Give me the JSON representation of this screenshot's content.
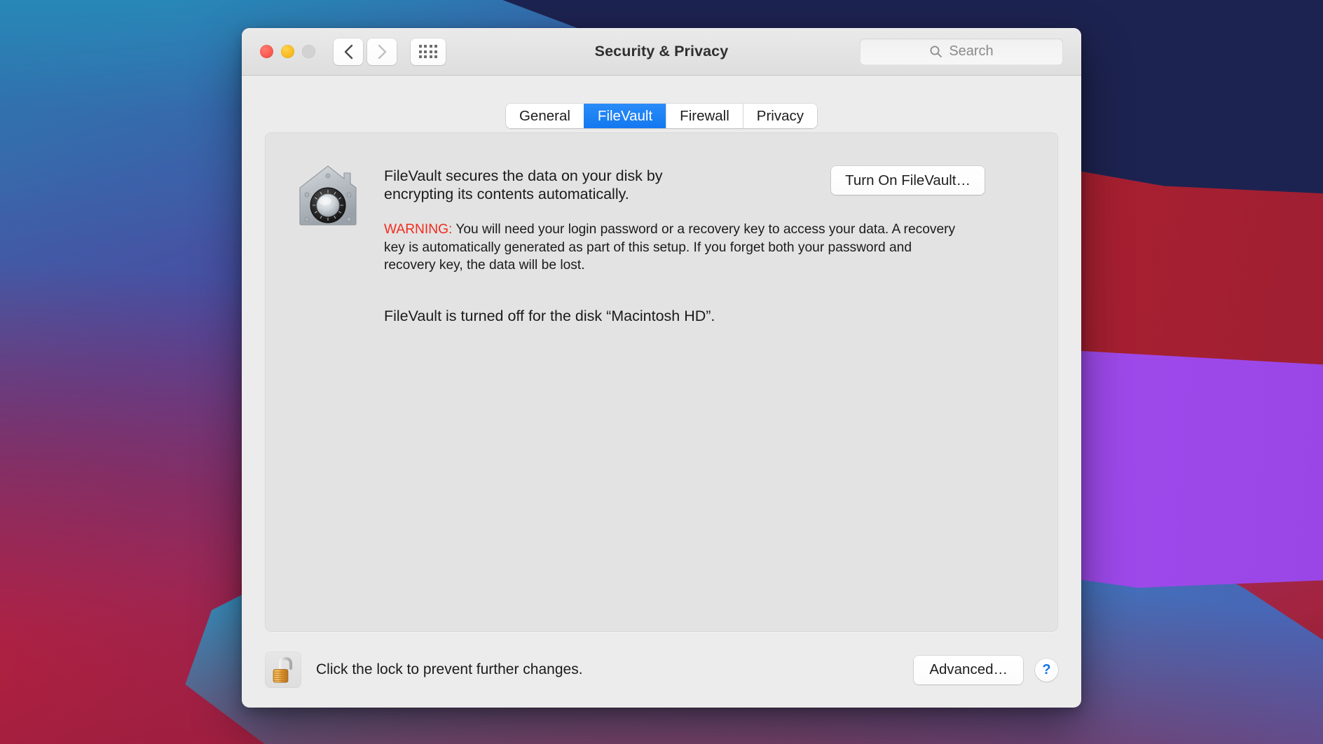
{
  "desktop": {
    "wallpaper_name": "big-sur-wallpaper",
    "colors": {
      "navy": "#1d2350",
      "red": "#c4262b",
      "purple": "#9a4ee8",
      "teal": "#2a9ec4",
      "blue": "#4a63b4",
      "crimson": "#a32440"
    }
  },
  "window": {
    "title": "Security & Privacy",
    "traffic_lights": {
      "close_label": "Close",
      "minimize_label": "Minimize",
      "zoom_label": "Zoom",
      "close_color": "#fa5d52",
      "minimize_color": "#f9bd23",
      "zoom_color": "#d2d2d2"
    },
    "nav": {
      "back_label": "Back",
      "forward_label": "Forward",
      "grid_label": "Show All"
    },
    "search": {
      "placeholder": "Search",
      "value": "",
      "icon": "search-icon"
    }
  },
  "tabs": [
    {
      "label": "General",
      "selected": false
    },
    {
      "label": "FileVault",
      "selected": true
    },
    {
      "label": "Firewall",
      "selected": false
    },
    {
      "label": "Privacy",
      "selected": false
    }
  ],
  "tab_accent_color": "#1378f0",
  "filevault": {
    "icon_name": "filevault-vault-icon",
    "description": "FileVault secures the data on your disk by encrypting its contents automatically.",
    "warning_label": "WARNING:",
    "warning_color": "#f12b1e",
    "warning_text": " You will need your login password or a recovery key to access your data. A recovery key is automatically generated as part of this setup. If you forget both your password and recovery key, the data will be lost.",
    "status": "FileVault is turned off for the disk “Macintosh HD”.",
    "turn_on_button": "Turn On FileVault…"
  },
  "bottom": {
    "lock_icon": "unlocked-padlock-icon",
    "lock_state": "unlocked",
    "lock_message": "Click the lock to prevent further changes.",
    "advanced_button": "Advanced…",
    "help_button": "?",
    "help_color": "#1673e8"
  }
}
